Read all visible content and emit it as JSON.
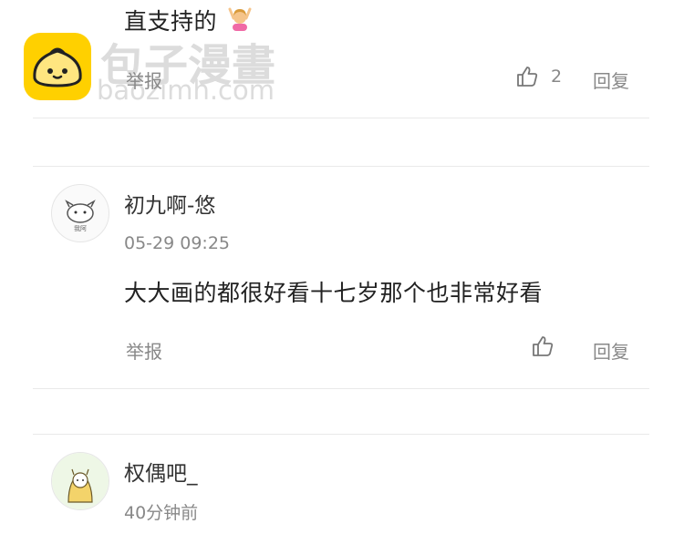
{
  "comments": [
    {
      "text": "直支持的",
      "report_label": "举报",
      "like_count": "2",
      "reply_label": "回复"
    },
    {
      "username": "初九啊-悠",
      "timestamp": "05-29 09:25",
      "text": "大大画的都很好看十七岁那个也非常好看",
      "report_label": "举报",
      "reply_label": "回复",
      "avatar_caption": "我阿"
    },
    {
      "username": "权偶吧_",
      "timestamp": "40分钟前"
    }
  ],
  "watermark": {
    "title": "包子漫畫",
    "domain": "baozimh.com"
  },
  "colors": {
    "logo_yellow": "#ffd000",
    "text_primary": "#222222",
    "text_secondary": "#888888",
    "divider": "#e9e9e9"
  },
  "icons": [
    "thumbs-up-icon",
    "person-raising-hands-emoji",
    "bun-logo-icon"
  ]
}
